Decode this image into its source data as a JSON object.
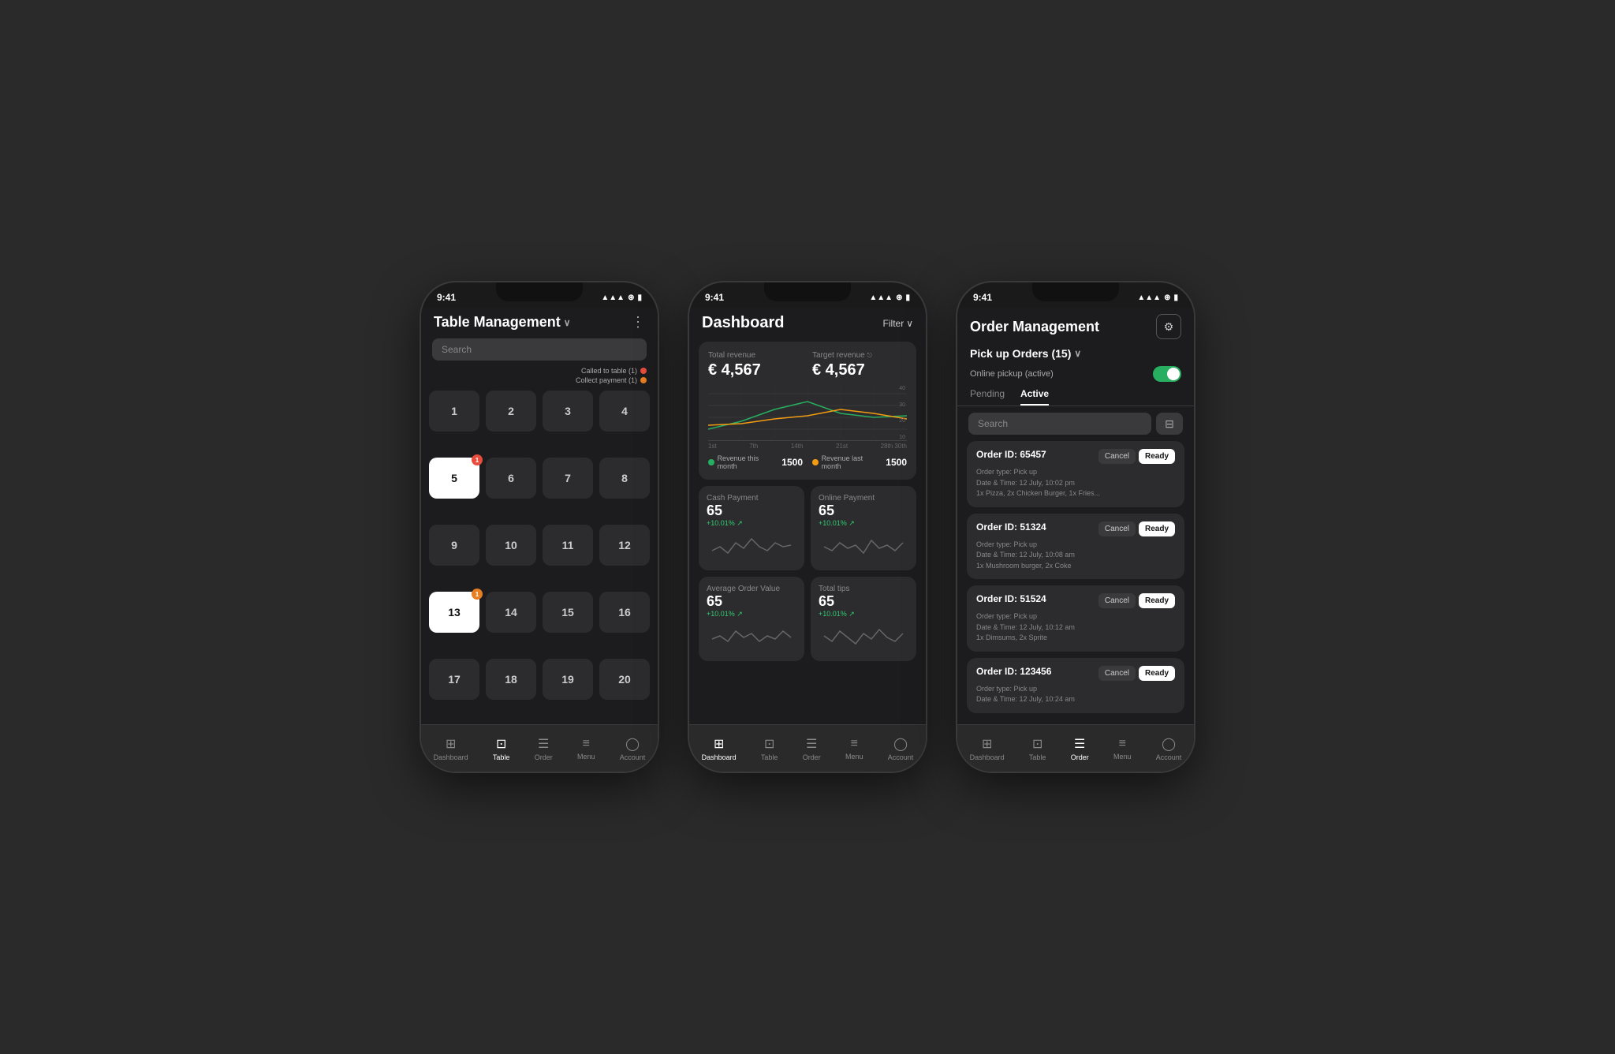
{
  "background": "#2a2a2a",
  "phones": [
    {
      "id": "table-management",
      "statusBar": {
        "time": "9:41",
        "signal": "▲▲▲",
        "wifi": "wifi",
        "battery": "battery"
      },
      "header": {
        "title": "Table Management",
        "menuIcon": "⋮"
      },
      "search": {
        "placeholder": "Search"
      },
      "legend": [
        {
          "label": "Called to table (1)",
          "color": "red"
        },
        {
          "label": "Collect payment (1)",
          "color": "orange"
        }
      ],
      "tables": [
        {
          "number": "1",
          "highlight": false,
          "badge": null
        },
        {
          "number": "2",
          "highlight": false,
          "badge": null
        },
        {
          "number": "3",
          "highlight": false,
          "badge": null
        },
        {
          "number": "4",
          "highlight": false,
          "badge": null
        },
        {
          "number": "5",
          "highlight": true,
          "badge": "red"
        },
        {
          "number": "6",
          "highlight": false,
          "badge": null
        },
        {
          "number": "7",
          "highlight": false,
          "badge": null
        },
        {
          "number": "8",
          "highlight": false,
          "badge": null
        },
        {
          "number": "9",
          "highlight": false,
          "badge": null
        },
        {
          "number": "10",
          "highlight": false,
          "badge": null
        },
        {
          "number": "11",
          "highlight": false,
          "badge": null
        },
        {
          "number": "12",
          "highlight": false,
          "badge": null
        },
        {
          "number": "13",
          "highlight": true,
          "badge": "orange"
        },
        {
          "number": "14",
          "highlight": false,
          "badge": null
        },
        {
          "number": "15",
          "highlight": false,
          "badge": null
        },
        {
          "number": "16",
          "highlight": false,
          "badge": null
        },
        {
          "number": "17",
          "highlight": false,
          "badge": null
        },
        {
          "number": "18",
          "highlight": false,
          "badge": null
        },
        {
          "number": "19",
          "highlight": false,
          "badge": null
        },
        {
          "number": "20",
          "highlight": false,
          "badge": null
        }
      ],
      "nav": [
        {
          "label": "Dashboard",
          "icon": "⊞",
          "active": false
        },
        {
          "label": "Table",
          "icon": "⊡",
          "active": true
        },
        {
          "label": "Order",
          "icon": "☰",
          "active": false
        },
        {
          "label": "Menu",
          "icon": "≡",
          "active": false
        },
        {
          "label": "Account",
          "icon": "◯",
          "active": false
        }
      ]
    },
    {
      "id": "dashboard",
      "statusBar": {
        "time": "9:41"
      },
      "header": {
        "title": "Dashboard",
        "filterLabel": "Filter"
      },
      "totalRevenue": {
        "label": "Total revenue",
        "value": "€ 4,567"
      },
      "targetRevenue": {
        "label": "Target revenue",
        "value": "€ 4,567"
      },
      "chartXLabels": [
        "1st",
        "7th",
        "14th",
        "21st",
        "28th 30th"
      ],
      "chartYLabels": [
        "40",
        "30",
        "20",
        "10"
      ],
      "legend": [
        {
          "label": "Revenue this month",
          "value": "1500",
          "color": "green"
        },
        {
          "label": "Revenue last month",
          "value": "1500",
          "color": "yellow"
        }
      ],
      "metrics": [
        {
          "label": "Cash Payment",
          "value": "65",
          "change": "+10.01% ↗"
        },
        {
          "label": "Online Payment",
          "value": "65",
          "change": "+10.01% ↗"
        },
        {
          "label": "Average Order Value",
          "value": "65",
          "change": "+10.01% ↗"
        },
        {
          "label": "Total tips",
          "value": "65",
          "change": "+10.01% ↗"
        }
      ],
      "nav": [
        {
          "label": "Dashboard",
          "icon": "⊞",
          "active": true
        },
        {
          "label": "Table",
          "icon": "⊡",
          "active": false
        },
        {
          "label": "Order",
          "icon": "☰",
          "active": false
        },
        {
          "label": "Menu",
          "icon": "≡",
          "active": false
        },
        {
          "label": "Account",
          "icon": "◯",
          "active": false
        }
      ]
    },
    {
      "id": "order-management",
      "statusBar": {
        "time": "9:41"
      },
      "header": {
        "title": "Order Management",
        "gearIcon": "⚙"
      },
      "pickupLabel": "Pick up Orders (15)",
      "onlinePickup": "Online pickup (active)",
      "tabs": [
        {
          "label": "Pending",
          "active": false
        },
        {
          "label": "Active",
          "active": true
        }
      ],
      "searchPlaceholder": "Search",
      "orders": [
        {
          "id": "Order ID: 65457",
          "type": "Order type: Pick up",
          "datetime": "Date & Time: 12 July, 10:02 pm",
          "items": "1x Pizza, 2x Chicken Burger, 1x Fries..."
        },
        {
          "id": "Order ID: 51324",
          "type": "Order type: Pick up",
          "datetime": "Date & Time: 12 July, 10:08 am",
          "items": "1x Mushroom burger, 2x Coke"
        },
        {
          "id": "Order ID: 51524",
          "type": "Order type: Pick up",
          "datetime": "Date & Time: 12 July, 10:12 am",
          "items": "1x Dimsums, 2x Sprite"
        },
        {
          "id": "Order ID: 123456",
          "type": "Order type: Pick up",
          "datetime": "Date & Time: 12 July, 10:24 am",
          "items": ""
        }
      ],
      "cancelLabel": "Cancel",
      "readyLabel": "Ready",
      "nav": [
        {
          "label": "Dashboard",
          "icon": "⊞",
          "active": false
        },
        {
          "label": "Table",
          "icon": "⊡",
          "active": false
        },
        {
          "label": "Order",
          "icon": "☰",
          "active": true
        },
        {
          "label": "Menu",
          "icon": "≡",
          "active": false
        },
        {
          "label": "Account",
          "icon": "◯",
          "active": false
        }
      ]
    }
  ]
}
